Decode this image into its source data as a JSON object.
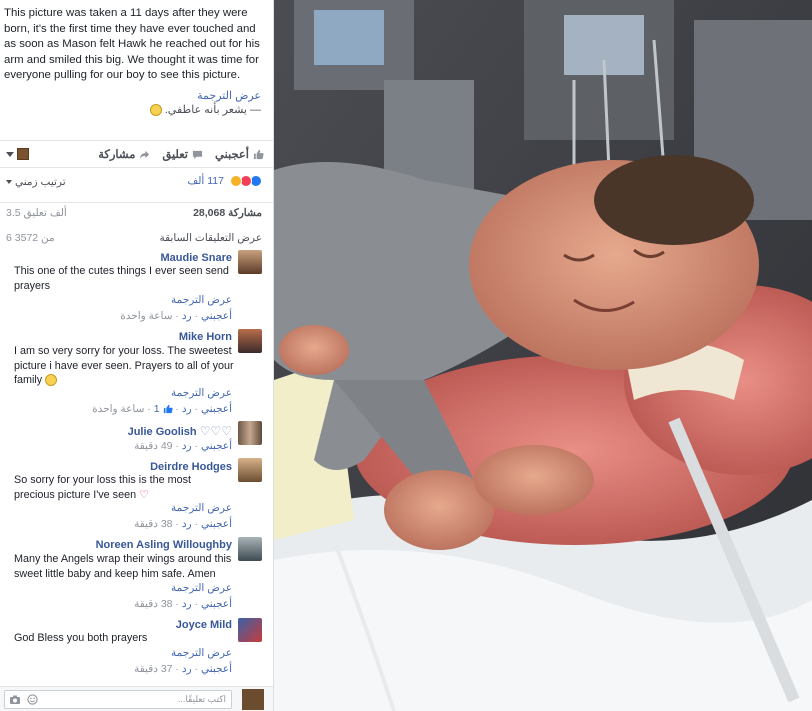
{
  "post": {
    "text": "This picture was taken a 11 days after they were born, it's the first time they have ever touched and as soon as Mason felt Hawk he reached out for his arm and smiled this big. We thought it was time for everyone pulling for our boy to see this picture.",
    "translate": "عرض الترجمة",
    "feeling": "— يشعر بأنه عاطفي."
  },
  "actions": {
    "like": "أعجبني",
    "comment": "تعليق",
    "share": "مشاركة"
  },
  "reactions": {
    "count": "117 ألف",
    "sort": "ترتيب زمني"
  },
  "stats": {
    "shares": "28,068 مشاركة",
    "comments": "3.5 ألف تعليق"
  },
  "previous": {
    "label": "عرض التعليقات السابقة",
    "pager": "6 من 3572"
  },
  "comments": [
    {
      "name": "Maudie Snare",
      "text": "This one of the cutes things I ever seen send prayers",
      "translate": "عرض الترجمة",
      "like": "أعجبني",
      "reply": "رد",
      "likes": "",
      "time": "ساعة واحدة"
    },
    {
      "name": "Mike Horn",
      "text": "I am so very sorry for your loss. The sweetest picture i have ever seen. Prayers to all of your family",
      "translate": "عرض الترجمة",
      "like": "أعجبني",
      "reply": "رد",
      "likes": "1",
      "time": "ساعة واحدة"
    },
    {
      "name": "Julie Goolish",
      "text": "",
      "translate": "",
      "like": "أعجبني",
      "reply": "رد",
      "likes": "",
      "time": "49 دقيقة"
    },
    {
      "name": "Deirdre Hodges",
      "text": "So sorry for your loss this is the most precious picture I've seen",
      "translate": "عرض الترجمة",
      "like": "أعجبني",
      "reply": "رد",
      "likes": "",
      "time": "38 دقيقة"
    },
    {
      "name": "Noreen Asling Willoughby",
      "text": "Many the Angels wrap their wings around this sweet little baby and keep him safe. Amen",
      "translate": "عرض الترجمة",
      "like": "أعجبني",
      "reply": "رد",
      "likes": "",
      "time": "38 دقيقة"
    },
    {
      "name": "Joyce Mild",
      "text": "God Bless you both prayers",
      "translate": "عرض الترجمة",
      "like": "أعجبني",
      "reply": "رد",
      "likes": "",
      "time": "37 دقيقة"
    }
  ],
  "composer": {
    "placeholder": "اكتب تعليقًا..."
  },
  "colors": {
    "link": "#4267b2",
    "name": "#385898",
    "like_reaction": "#2078f4",
    "love_reaction": "#f33e58",
    "haha_reaction": "#f7b125"
  },
  "icons": [
    "like-icon",
    "comment-icon",
    "share-icon",
    "camera-icon",
    "emoji-icon",
    "chevron-down-icon"
  ]
}
